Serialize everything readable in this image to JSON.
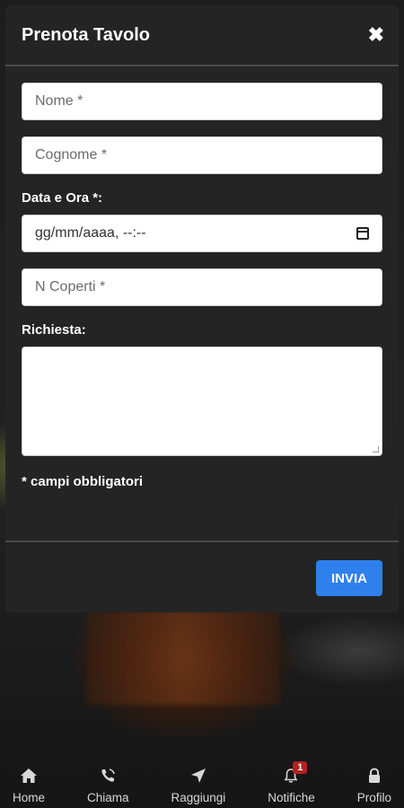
{
  "modal": {
    "title": "Prenota Tavolo",
    "close_icon": "close-icon",
    "fields": {
      "nome_placeholder": "Nome *",
      "cognome_placeholder": "Cognome *",
      "datetime_label": "Data e Ora *:",
      "datetime_placeholder": "gg/mm/aaaa, --:--",
      "coperti_placeholder": "N Coperti *",
      "richiesta_label": "Richiesta:"
    },
    "required_note": "* campi obbligatori",
    "submit_label": "INVIA"
  },
  "bottom_nav": {
    "items": [
      {
        "label": "Home",
        "icon": "home-icon"
      },
      {
        "label": "Chiama",
        "icon": "phone-icon"
      },
      {
        "label": "Raggiungi",
        "icon": "location-arrow-icon"
      },
      {
        "label": "Notifiche",
        "icon": "bell-icon",
        "badge": "1"
      },
      {
        "label": "Profilo",
        "icon": "lock-icon"
      }
    ]
  },
  "colors": {
    "accent": "#2f80ed",
    "badge": "#b22222",
    "modal_bg": "#242424"
  }
}
